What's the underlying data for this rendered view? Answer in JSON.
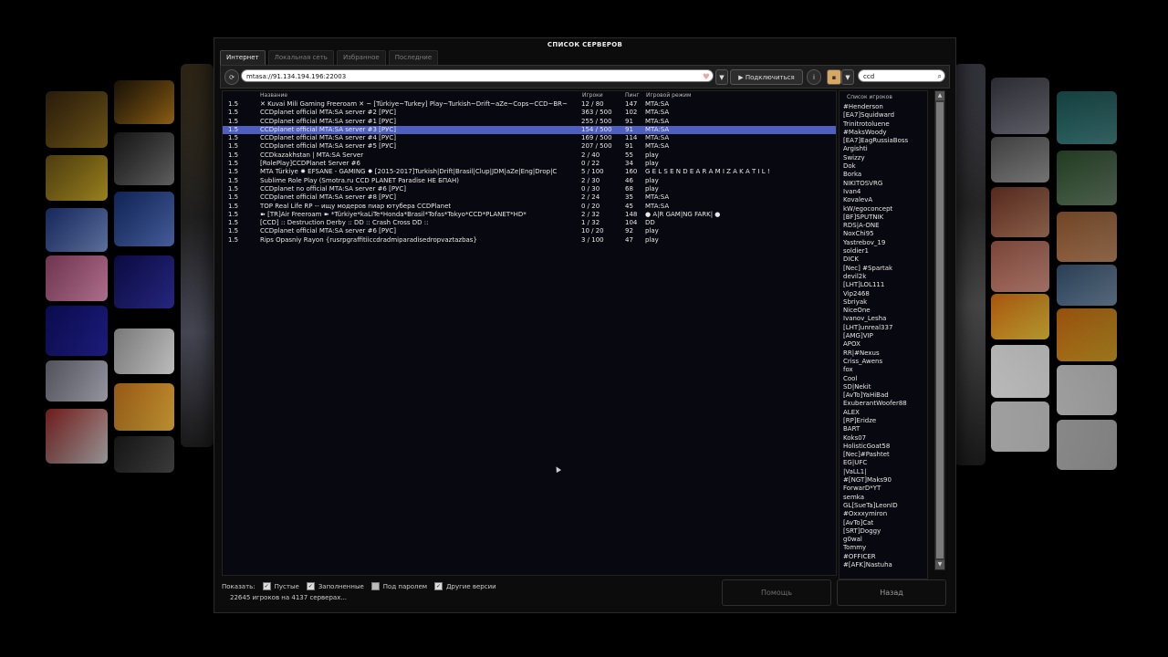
{
  "window": {
    "title": "СПИСОК СЕРВЕРОВ"
  },
  "tabs": [
    {
      "label": "Интернет",
      "active": true
    },
    {
      "label": "Локальная сеть",
      "active": false
    },
    {
      "label": "Избранное",
      "active": false
    },
    {
      "label": "Последние",
      "active": false
    }
  ],
  "toolbar": {
    "address_value": "mtasa://91.134.194.196:22003",
    "connect_label": "▶ Подключиться",
    "info_icon": "i",
    "search_value": "ccd"
  },
  "columns": {
    "name": "Название",
    "players": "Игроки",
    "ping": "Пинг",
    "mode": "Игровой режим"
  },
  "servers": [
    {
      "ver": "1.5",
      "name": "✕ Kuvai Mili Gaming Freeroam ✕ ~ [Türkiye~Turkey] Play~Turkish~Drift~aZe~Cops~CCD~BR~",
      "players": "12 / 80",
      "ping": "147",
      "mode": "MTA:SA",
      "selected": false
    },
    {
      "ver": "1.5",
      "name": "CCDplanet official MTA:SA server #2 [РУС]",
      "players": "363 / 500",
      "ping": "102",
      "mode": "MTA:SA",
      "selected": false
    },
    {
      "ver": "1.5",
      "name": "CCDplanet official MTA:SA server #1 [РУС]",
      "players": "255 / 500",
      "ping": "91",
      "mode": "MTA:SA",
      "selected": false
    },
    {
      "ver": "1.5",
      "name": "CCDplanet official MTA:SA server #3 [РУС]",
      "players": "154 / 500",
      "ping": "91",
      "mode": "MTA:SA",
      "selected": true
    },
    {
      "ver": "1.5",
      "name": "CCDplanet official MTA:SA server #4 [РУС]",
      "players": "169 / 500",
      "ping": "114",
      "mode": "MTA:SA",
      "selected": false
    },
    {
      "ver": "1.5",
      "name": "CCDplanet official MTA:SA server #5 [РУС]",
      "players": "207 / 500",
      "ping": "91",
      "mode": "MTA:SA",
      "selected": false
    },
    {
      "ver": "1.5",
      "name": "CCDkazakhstan | MTA:SA Server",
      "players": "2 / 40",
      "ping": "55",
      "mode": "play",
      "selected": false
    },
    {
      "ver": "1.5",
      "name": "[RolePlay]CCDPlanet Server #6",
      "players": "0 / 22",
      "ping": "34",
      "mode": "play",
      "selected": false
    },
    {
      "ver": "1.5",
      "name": "MTA Türkiye ✸ EFSANE - GAMING ✸ [2015-2017]Turkish|Drift|Brasil|Clup|JDM|aZe|Eng|Drop|C",
      "players": "5 / 100",
      "ping": "160",
      "mode": "G E L  S E N D E  A R A M I Z A  K A T I L  !",
      "selected": false
    },
    {
      "ver": "1.5",
      "name": "Sublime Role Play (Smotra.ru CCD PLANET Paradise НЕ БПАН)",
      "players": "2 / 30",
      "ping": "46",
      "mode": "play",
      "selected": false
    },
    {
      "ver": "1.5",
      "name": "CCDplanet no official MTA:SA server #6 [РУС]",
      "players": "0 / 30",
      "ping": "68",
      "mode": "play",
      "selected": false
    },
    {
      "ver": "1.5",
      "name": "CCDplanet official MTA:SA server #8 [РУС]",
      "players": "2 / 24",
      "ping": "35",
      "mode": "MTA:SA",
      "selected": false
    },
    {
      "ver": "1.5",
      "name": "TOP Real Life RP -- ищу модеров пиар ютубера CCDPlanet",
      "players": "0 / 20",
      "ping": "45",
      "mode": "MTA:SA",
      "selected": false
    },
    {
      "ver": "1.5",
      "name": "➽ [TR]Air Freeroam ➽ *Türkiye*kaLiTe*Honda*Brasil*Tofas*Tokyo*CCD*PLANET*HD*",
      "players": "2 / 32",
      "ping": "148",
      "mode": "● A|R GAM|NG FARK| ●",
      "selected": false
    },
    {
      "ver": "1.5",
      "name": "[CCD] :: Destruction Derby :: DD :: Crash Cross DD ::",
      "players": "1 / 32",
      "ping": "104",
      "mode": "DD",
      "selected": false
    },
    {
      "ver": "1.5",
      "name": "CCDplanet official MTA:SA server #6 [РУС]",
      "players": "10 / 20",
      "ping": "92",
      "mode": "play",
      "selected": false
    },
    {
      "ver": "1.5",
      "name": "Rips Opasniy Rayon {rusrpgraffitiiccdradmiparadisedropvaztazbas}",
      "players": "3 / 100",
      "ping": "47",
      "mode": "play",
      "selected": false
    }
  ],
  "players_header": "Список игроков",
  "players": [
    "#Henderson",
    "[EA7]Squidward",
    "Trinitrotoluene",
    "#MaksWoody",
    "[EA7]EagRussiaBoss",
    "Argishti",
    "Swizzy",
    "Dok",
    "Borka",
    "NIKITOSVRG",
    "Ivan4",
    "KovalevA",
    "kW/egoconcept",
    "[BF]SPUTNIK",
    "RDS|A-ONE",
    "NoxChi95",
    "Yastrebov_19",
    "soldier1",
    "DICK",
    "[Nec] #Spartak",
    "devil2k",
    "[LHT]LOL111",
    "Vip2468",
    "Sbriyak",
    "NiceOne",
    "Ivanov_Lesha",
    "[LHT]unreal337",
    "[AMG]VIP",
    "APOX",
    "RR|#Nexus",
    "Criss_Awens",
    "fox",
    "Cool",
    "SD|Nekit",
    "[AvTo]YaHiBad",
    "ExuberantWoofer88",
    "ALEX",
    "[RP]Eridze",
    "BART",
    "Koks07",
    "HolisticGoat58",
    "[Nec]#Pashtet",
    "EG|UFC",
    "|VaLL1|",
    "#[NGT]Maks90",
    "ForwarD*YT",
    "semka",
    "GL[SueTa]LeonID",
    "#Oxxxymiron",
    "[AvTo]Cat",
    "[SRT]Doggy",
    "g0wal",
    "Tommy",
    "#OFFICER",
    "#[AFK]Nastuha"
  ],
  "filters": {
    "show_label": "Показать:",
    "items": [
      {
        "label": "Пустые",
        "checked": true
      },
      {
        "label": "Заполненные",
        "checked": true
      },
      {
        "label": "Под паролем",
        "checked": false
      },
      {
        "label": "Другие версии",
        "checked": true
      }
    ]
  },
  "status_text": "22645 игроков на 4137 серверах...",
  "buttons": {
    "help": "Помощь",
    "back": "Назад"
  },
  "colors": {
    "selection": "#4f5fbe",
    "window_bg": "#0c0c0c"
  }
}
